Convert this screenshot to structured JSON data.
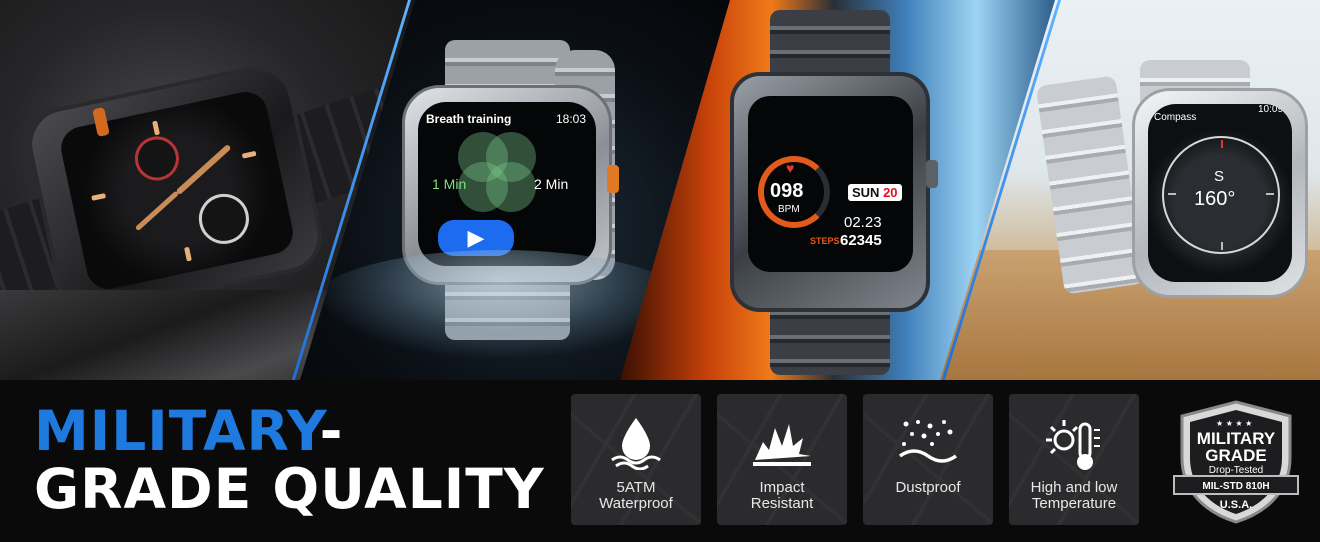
{
  "photos": {
    "watch2": {
      "screen_title": "Breath training",
      "screen_time": "18:03",
      "label_left": "1 Min",
      "label_right": "2 Min",
      "play_icon": "play-icon"
    },
    "watch3": {
      "heart_rate": "098",
      "heart_unit": "BPM",
      "day": "SUN",
      "day_number": "20",
      "date": "02.23",
      "steps_label": "STEPS",
      "steps_value": "62345"
    },
    "watch4": {
      "app_title": "Compass",
      "time": "10:09",
      "direction": "S",
      "heading": "160°"
    }
  },
  "headline": {
    "line1_accent": "MILITARY",
    "line1_dash": "-",
    "line2": "GRADE QUALITY",
    "accent_color": "#1f7ae0"
  },
  "features": [
    {
      "icon": "water-drop-icon",
      "label": "5ATM\nWaterproof"
    },
    {
      "icon": "impact-burst-icon",
      "label": "Impact\nResistant"
    },
    {
      "icon": "dust-particles-icon",
      "label": "Dustproof"
    },
    {
      "icon": "thermometer-sun-icon",
      "label": "High and low\nTemperature"
    }
  ],
  "badge": {
    "icon": "shield-badge-icon",
    "line1": "MILITARY",
    "line2": "GRADE",
    "line3": "Drop-Tested",
    "line4": "MIL-STD 810H",
    "line5": "U.S.A."
  }
}
